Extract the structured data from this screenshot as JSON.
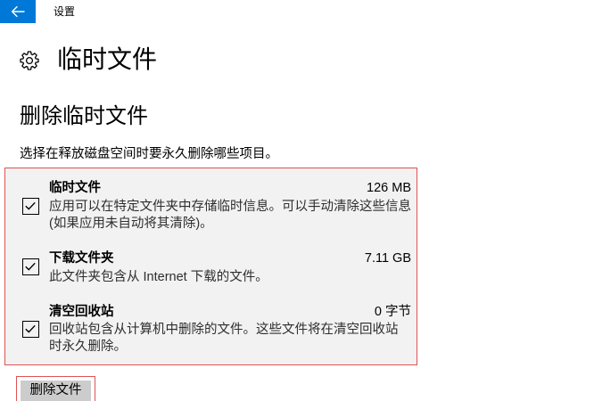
{
  "window": {
    "app_title": "设置"
  },
  "page": {
    "title": "临时文件"
  },
  "section": {
    "heading": "删除临时文件",
    "description": "选择在释放磁盘空间时要永久删除哪些项目。"
  },
  "items": [
    {
      "title": "临时文件",
      "size": "126 MB",
      "description": "应用可以在特定文件夹中存储临时信息。可以手动清除这些信息(如果应用未自动将其清除)。",
      "checked": true
    },
    {
      "title": "下载文件夹",
      "size": "7.11 GB",
      "description": "此文件夹包含从 Internet 下载的文件。",
      "checked": true
    },
    {
      "title": "清空回收站",
      "size": "0 字节",
      "description": "回收站包含从计算机中删除的文件。这些文件将在清空回收站时永久删除。",
      "checked": true
    }
  ],
  "actions": {
    "delete_label": "删除文件"
  },
  "icons": {
    "back": "back-arrow-icon",
    "page": "gear-icon",
    "check": "checkmark-icon"
  },
  "colors": {
    "accent": "#0078d7",
    "highlight": "#e05252",
    "button_bg": "#cccccc",
    "panel_bg": "#f2f2f2"
  }
}
